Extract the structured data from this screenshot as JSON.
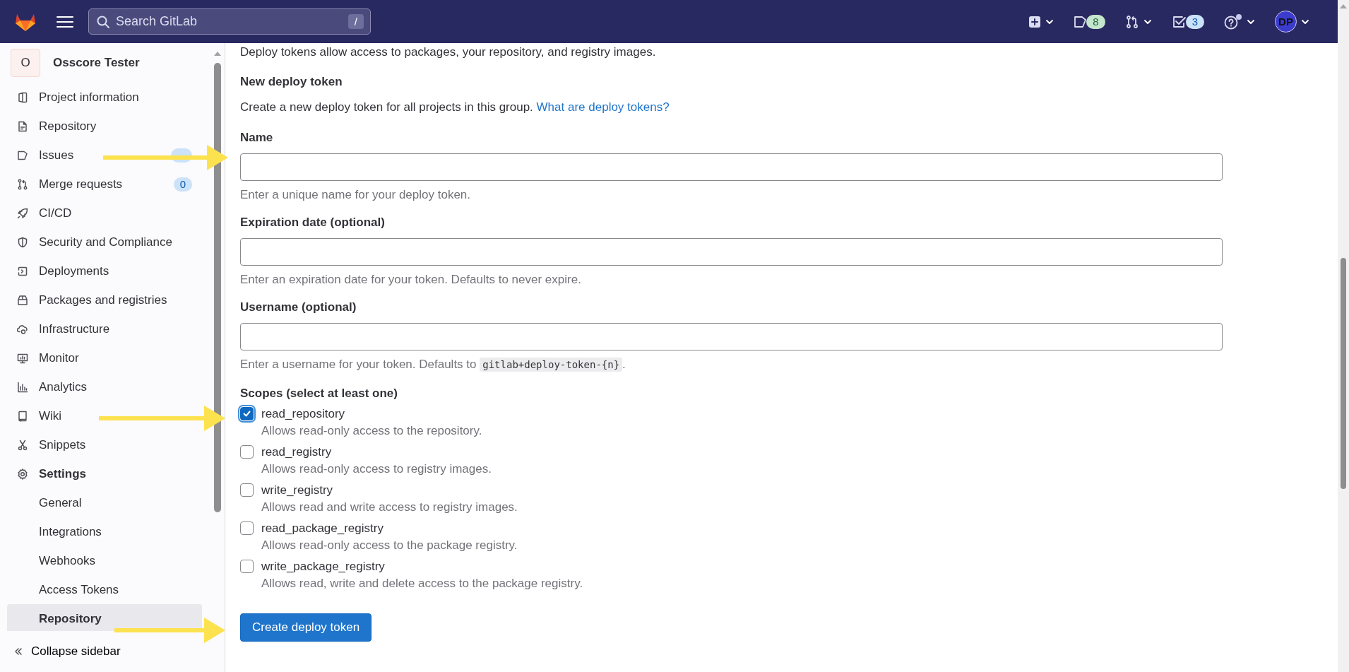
{
  "header": {
    "search": {
      "placeholder": "Search GitLab",
      "shortcut": "/"
    },
    "issues_count": "8",
    "todos_count": "3",
    "avatar": "DP"
  },
  "sidebar": {
    "project": {
      "initial": "O",
      "name": "Osscore Tester"
    },
    "items": [
      {
        "label": "Project information",
        "selected": false,
        "expanded": false
      },
      {
        "label": "Repository",
        "selected": false,
        "expanded": false
      },
      {
        "label": "Issues",
        "badge_covered": true,
        "selected": false,
        "expanded": false
      },
      {
        "label": "Merge requests",
        "badge": "0",
        "selected": false,
        "expanded": false
      },
      {
        "label": "CI/CD",
        "selected": false,
        "expanded": false
      },
      {
        "label": "Security and Compliance",
        "selected": false,
        "expanded": false
      },
      {
        "label": "Deployments",
        "selected": false,
        "expanded": false
      },
      {
        "label": "Packages and registries",
        "selected": false,
        "expanded": false
      },
      {
        "label": "Infrastructure",
        "selected": false,
        "expanded": false
      },
      {
        "label": "Monitor",
        "selected": false,
        "expanded": false
      },
      {
        "label": "Analytics",
        "selected": false,
        "expanded": false
      },
      {
        "label": "Wiki",
        "selected": false,
        "expanded": false
      },
      {
        "label": "Snippets",
        "selected": false,
        "expanded": false
      },
      {
        "label": "Settings",
        "selected": false,
        "expanded": true,
        "children": [
          {
            "label": "General",
            "selected": false
          },
          {
            "label": "Integrations",
            "selected": false
          },
          {
            "label": "Webhooks",
            "selected": false
          },
          {
            "label": "Access Tokens",
            "selected": false
          },
          {
            "label": "Repository",
            "selected": true
          }
        ]
      }
    ],
    "collapse": "Collapse sidebar"
  },
  "main": {
    "intro": "Deploy tokens allow access to packages, your repository, and registry images.",
    "title": "New deploy token",
    "description": "Create a new deploy token for all projects in this group.",
    "link": "What are deploy tokens?",
    "fields": [
      {
        "label": "Name",
        "help": "Enter a unique name for your deploy token."
      },
      {
        "label": "Expiration date (optional)",
        "help": "Enter an expiration date for your token. Defaults to never expire."
      },
      {
        "label": "Username (optional)",
        "help": "Enter a username for your token. Defaults to ",
        "help_code": "gitlab+deploy-token-{n}",
        "help_after": "."
      }
    ],
    "scopes_label": "Scopes (select at least one)",
    "scopes": [
      {
        "name": "read_repository",
        "description": "Allows read-only access to the repository.",
        "checked": true
      },
      {
        "name": "read_registry",
        "description": "Allows read-only access to registry images.",
        "checked": false
      },
      {
        "name": "write_registry",
        "description": "Allows read and write access to registry images.",
        "checked": false
      },
      {
        "name": "read_package_registry",
        "description": "Allows read-only access to the package registry.",
        "checked": false
      },
      {
        "name": "write_package_registry",
        "description": "Allows read, write and delete access to the package registry.",
        "checked": false
      }
    ],
    "submit": "Create deploy token"
  }
}
